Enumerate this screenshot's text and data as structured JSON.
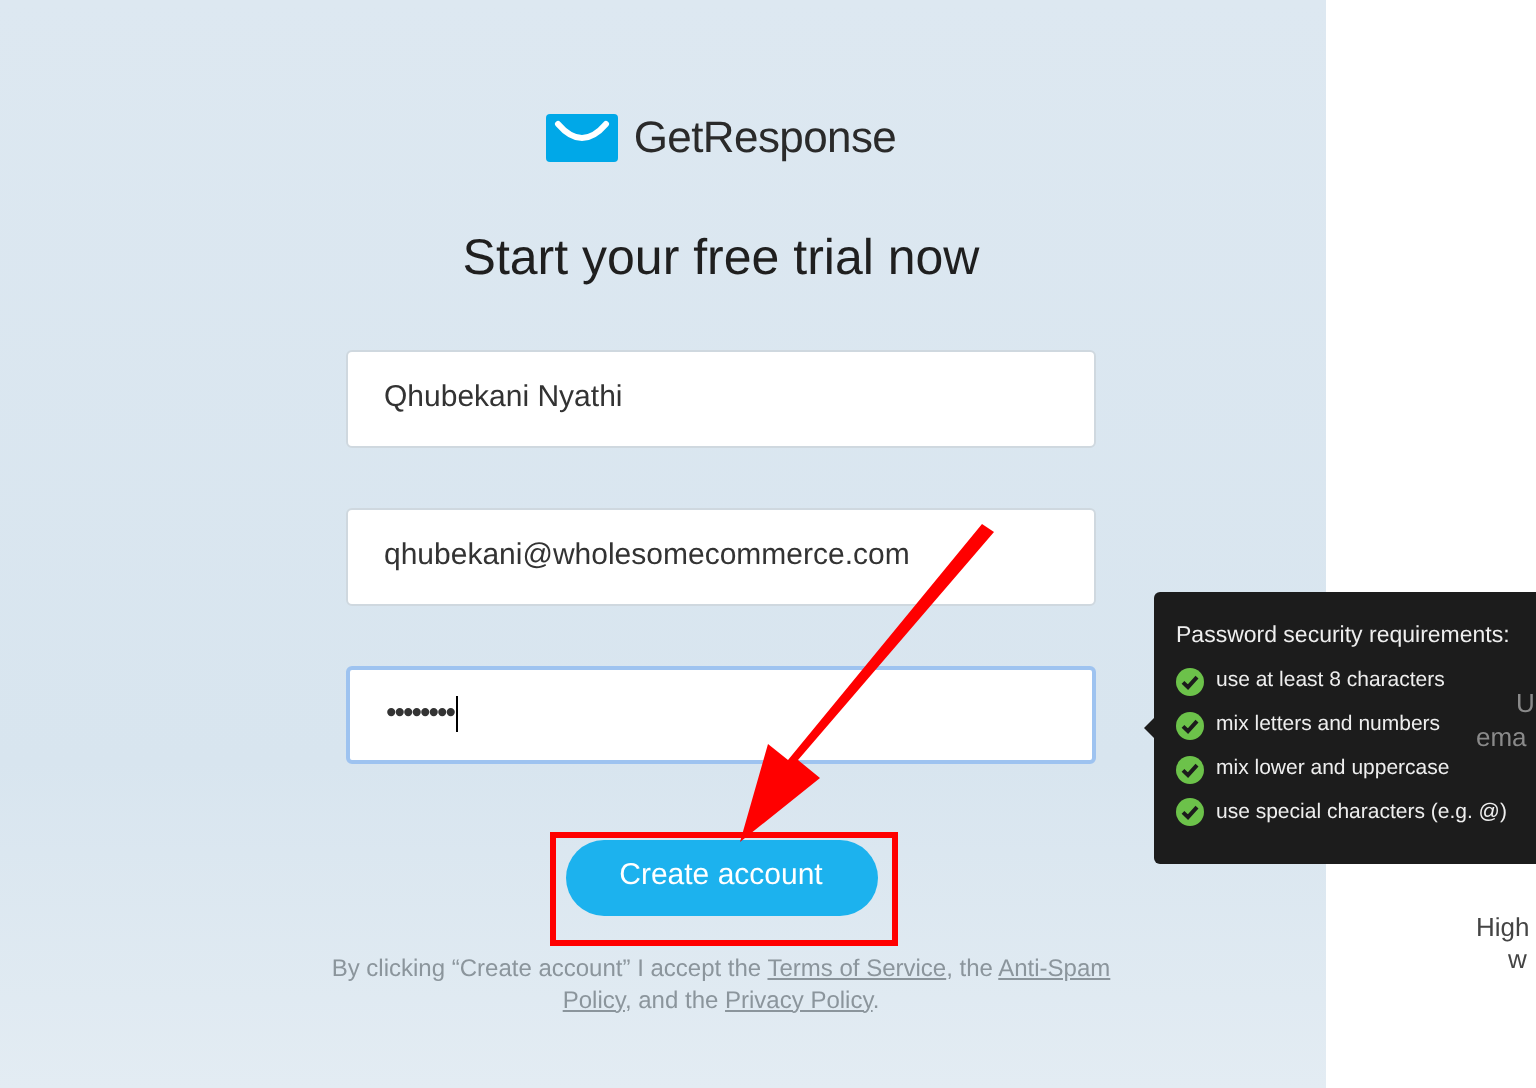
{
  "logo": {
    "name": "GetResponse"
  },
  "title": "Start your free trial now",
  "fields": [
    {
      "kind": "text",
      "value": "Qhubekani Nyathi",
      "focused": false
    },
    {
      "kind": "text",
      "value": "qhubekani@wholesomecommerce.com",
      "focused": false
    },
    {
      "kind": "password",
      "value": "••••••••",
      "focused": true
    }
  ],
  "submit": {
    "label": "Create account"
  },
  "legal": [
    {
      "kind": "text",
      "text": "By clicking “Create account” I accept the "
    },
    {
      "kind": "link",
      "text": "Terms of Service"
    },
    {
      "kind": "text",
      "text": ", the "
    },
    {
      "kind": "link",
      "text": "Anti-Spam Policy"
    },
    {
      "kind": "text",
      "text": ", and the "
    },
    {
      "kind": "link",
      "text": "Privacy Policy"
    },
    {
      "kind": "text",
      "text": "."
    }
  ],
  "tooltip": {
    "title": "Password security requirements:",
    "requirements": [
      {
        "text": "use at least 8 characters",
        "met": true
      },
      {
        "text": "mix letters and numbers",
        "met": true
      },
      {
        "text": "mix lower and uppercase",
        "met": true
      },
      {
        "text": "use special characters (e.g. @)",
        "met": true
      }
    ]
  },
  "right_panel": {
    "fragments": [
      "U",
      "ema",
      "High",
      "w"
    ]
  }
}
